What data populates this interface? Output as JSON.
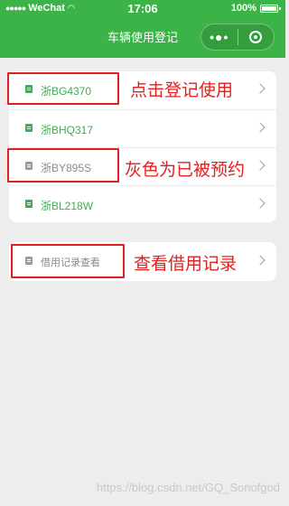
{
  "status_bar": {
    "carrier": "WeChat",
    "time": "17:06",
    "battery": "100%"
  },
  "nav": {
    "title": "车辆使用登记"
  },
  "vehicles": [
    {
      "plate": "浙BG4370",
      "state": "available"
    },
    {
      "plate": "浙BHQ317",
      "state": "available"
    },
    {
      "plate": "浙BY895S",
      "state": "reserved"
    },
    {
      "plate": "浙BL218W",
      "state": "available"
    }
  ],
  "records_link": {
    "label": "借用记录查看"
  },
  "annotations": {
    "click_register": "点击登记使用",
    "gray_reserved": "灰色为已被预约",
    "view_records": "查看借用记录"
  },
  "watermark": "https://blog.csdn.net/GQ_Sonofgod",
  "colors": {
    "nav_green": "#3cb346",
    "available_green": "#45a957",
    "reserved_gray": "#8a8a8a",
    "annotation_red": "#e02020"
  }
}
